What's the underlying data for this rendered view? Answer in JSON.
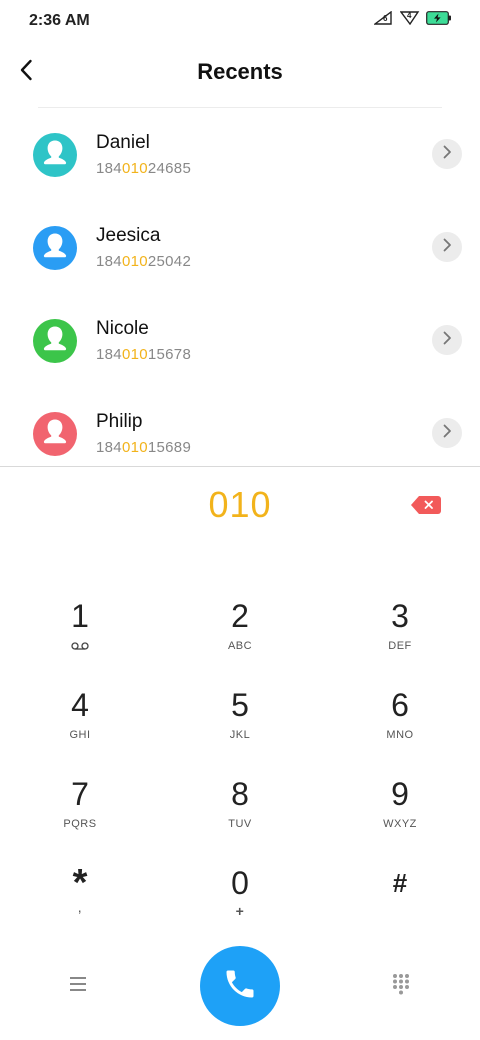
{
  "status_bar": {
    "time": "2:36 AM",
    "icons": [
      "signal-sim1-icon",
      "signal-sim2-icon",
      "battery-charging-icon"
    ],
    "sim1_badge": "6",
    "sim2_badge": "4",
    "battery_color": "#3ddc97"
  },
  "header": {
    "title": "Recents",
    "back_icon": "chevron-left-icon"
  },
  "recents": [
    {
      "name": "Daniel",
      "number_pre": "184",
      "number_match": "010",
      "number_post": "24685",
      "avatar_color": "#2ec4c7"
    },
    {
      "name": "Jeesica",
      "number_pre": "184",
      "number_match": "010",
      "number_post": "25042",
      "avatar_color": "#2a9df4"
    },
    {
      "name": "Nicole",
      "number_pre": "184",
      "number_match": "010",
      "number_post": "15678",
      "avatar_color": "#3cc54a"
    },
    {
      "name": "Philip",
      "number_pre": "184",
      "number_match": "010",
      "number_post": "15689",
      "avatar_color": "#f1646f"
    }
  ],
  "dialer": {
    "entered_number": "010",
    "entered_color": "#f2b31b",
    "delete_color": "#f25a5a"
  },
  "keypad": {
    "keys": [
      {
        "digit": "1",
        "letters": "",
        "sub_icon": "voicemail-icon"
      },
      {
        "digit": "2",
        "letters": "ABC"
      },
      {
        "digit": "3",
        "letters": "DEF"
      },
      {
        "digit": "4",
        "letters": "GHI"
      },
      {
        "digit": "5",
        "letters": "JKL"
      },
      {
        "digit": "6",
        "letters": "MNO"
      },
      {
        "digit": "7",
        "letters": "PQRS"
      },
      {
        "digit": "8",
        "letters": "TUV"
      },
      {
        "digit": "9",
        "letters": "WXYZ"
      },
      {
        "digit": "*",
        "letters": ","
      },
      {
        "digit": "0",
        "letters": "+"
      },
      {
        "digit": "#",
        "letters": ""
      }
    ]
  },
  "bottom_bar": {
    "menu_icon": "menu-icon",
    "call_icon": "phone-icon",
    "call_color": "#1ea1f7",
    "keypad_icon": "dialpad-icon"
  }
}
